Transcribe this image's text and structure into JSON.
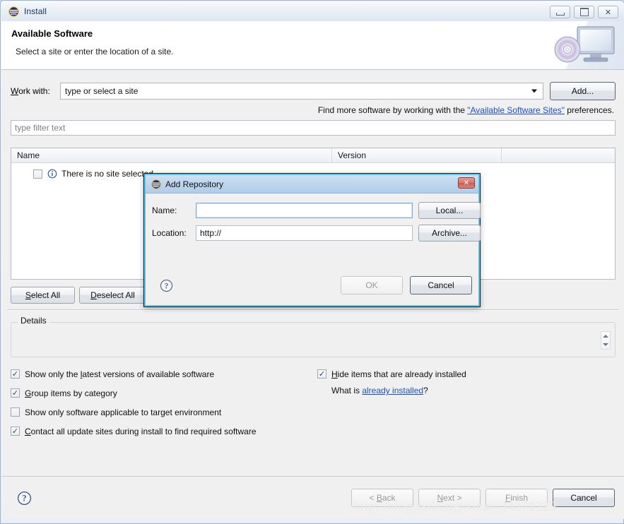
{
  "window": {
    "title": "Install",
    "app_icon": "eclipse-icon",
    "controls": {
      "minimize": "minimize-button",
      "maximize": "maximize-button",
      "close": "close-button",
      "close_glyph": "✕"
    }
  },
  "banner": {
    "title": "Available Software",
    "subtitle": "Select a site or enter the location of a site.",
    "art": "monitor-disc-graphic"
  },
  "work_with": {
    "label": "Work with:",
    "value": "type or select a site",
    "placeholder": "type or select a site",
    "add_button": "Add..."
  },
  "find_more": {
    "prefix": "Find more software by working with the ",
    "link": "\"Available Software Sites\"",
    "suffix": " preferences."
  },
  "filter": {
    "placeholder": "type filter text",
    "value": ""
  },
  "table": {
    "columns": [
      "Name",
      "Version",
      ""
    ],
    "rows": [
      {
        "checked": false,
        "icon": "info-icon",
        "name": "There is no site selected.",
        "version": ""
      }
    ]
  },
  "list_actions": {
    "select_all": "Select All",
    "deselect_all": "Deselect All"
  },
  "details": {
    "legend": "Details",
    "text": ""
  },
  "options": {
    "left": [
      {
        "label": "Show only the latest versions of available software",
        "checked": true
      },
      {
        "label": "Group items by category",
        "checked": true
      },
      {
        "label": "Show only software applicable to target environment",
        "checked": false
      },
      {
        "label": "Contact all update sites during install to find required software",
        "checked": true
      }
    ],
    "right": [
      {
        "label": "Hide items that are already installed",
        "checked": true
      }
    ],
    "what_is": {
      "prefix": "What is ",
      "link": "already installed",
      "suffix": "?"
    }
  },
  "footer": {
    "help": "help-icon",
    "buttons": [
      {
        "label": "< Back",
        "enabled": false
      },
      {
        "label": "Next >",
        "enabled": false
      },
      {
        "label": "Finish",
        "enabled": false
      },
      {
        "label": "Cancel",
        "enabled": true
      }
    ]
  },
  "watermark": "http://blog.csdn.net/sinat_34271329",
  "modal": {
    "title": "Add Repository",
    "icon": "eclipse-icon",
    "close_glyph": "✕",
    "name": {
      "label": "Name:",
      "value": "",
      "button": "Local..."
    },
    "location": {
      "label": "Location:",
      "value": "http://",
      "button": "Archive..."
    },
    "help": "help-icon",
    "ok": {
      "label": "OK",
      "enabled": false
    },
    "cancel": {
      "label": "Cancel",
      "enabled": true
    }
  }
}
